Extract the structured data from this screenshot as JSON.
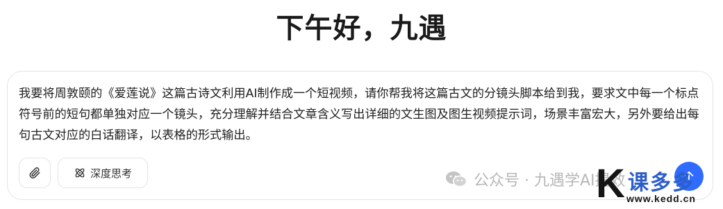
{
  "greeting": "下午好，九遇",
  "composer": {
    "prompt_text": "我要将周敦颐的《爱莲说》这篇古诗文利用AI制作成一个短视频，请你帮我将这篇古文的分镜头脚本给到我，要求文中每一个标点符号前的短句都单独对应一个镜头，充分理解并结合文章含义写出详细的文生图及图生视频提示词，场景丰富宏大，另外要给出每句古文对应的白话翻译，以表格的形式输出。",
    "attach_icon": "paperclip-icon",
    "deep_think_label": "深度思考",
    "deep_think_icon": "atom-icon",
    "send_icon": "send-icon"
  },
  "watermark": {
    "text": "公众号 · 九遇学AI提效",
    "icon": "wechat-icon"
  },
  "logo": {
    "letter": "K",
    "name": "课多多",
    "url": "www.kedd.cn"
  },
  "colors": {
    "accent": "#2f6bff",
    "logo_blue": "#2b5ec9"
  }
}
